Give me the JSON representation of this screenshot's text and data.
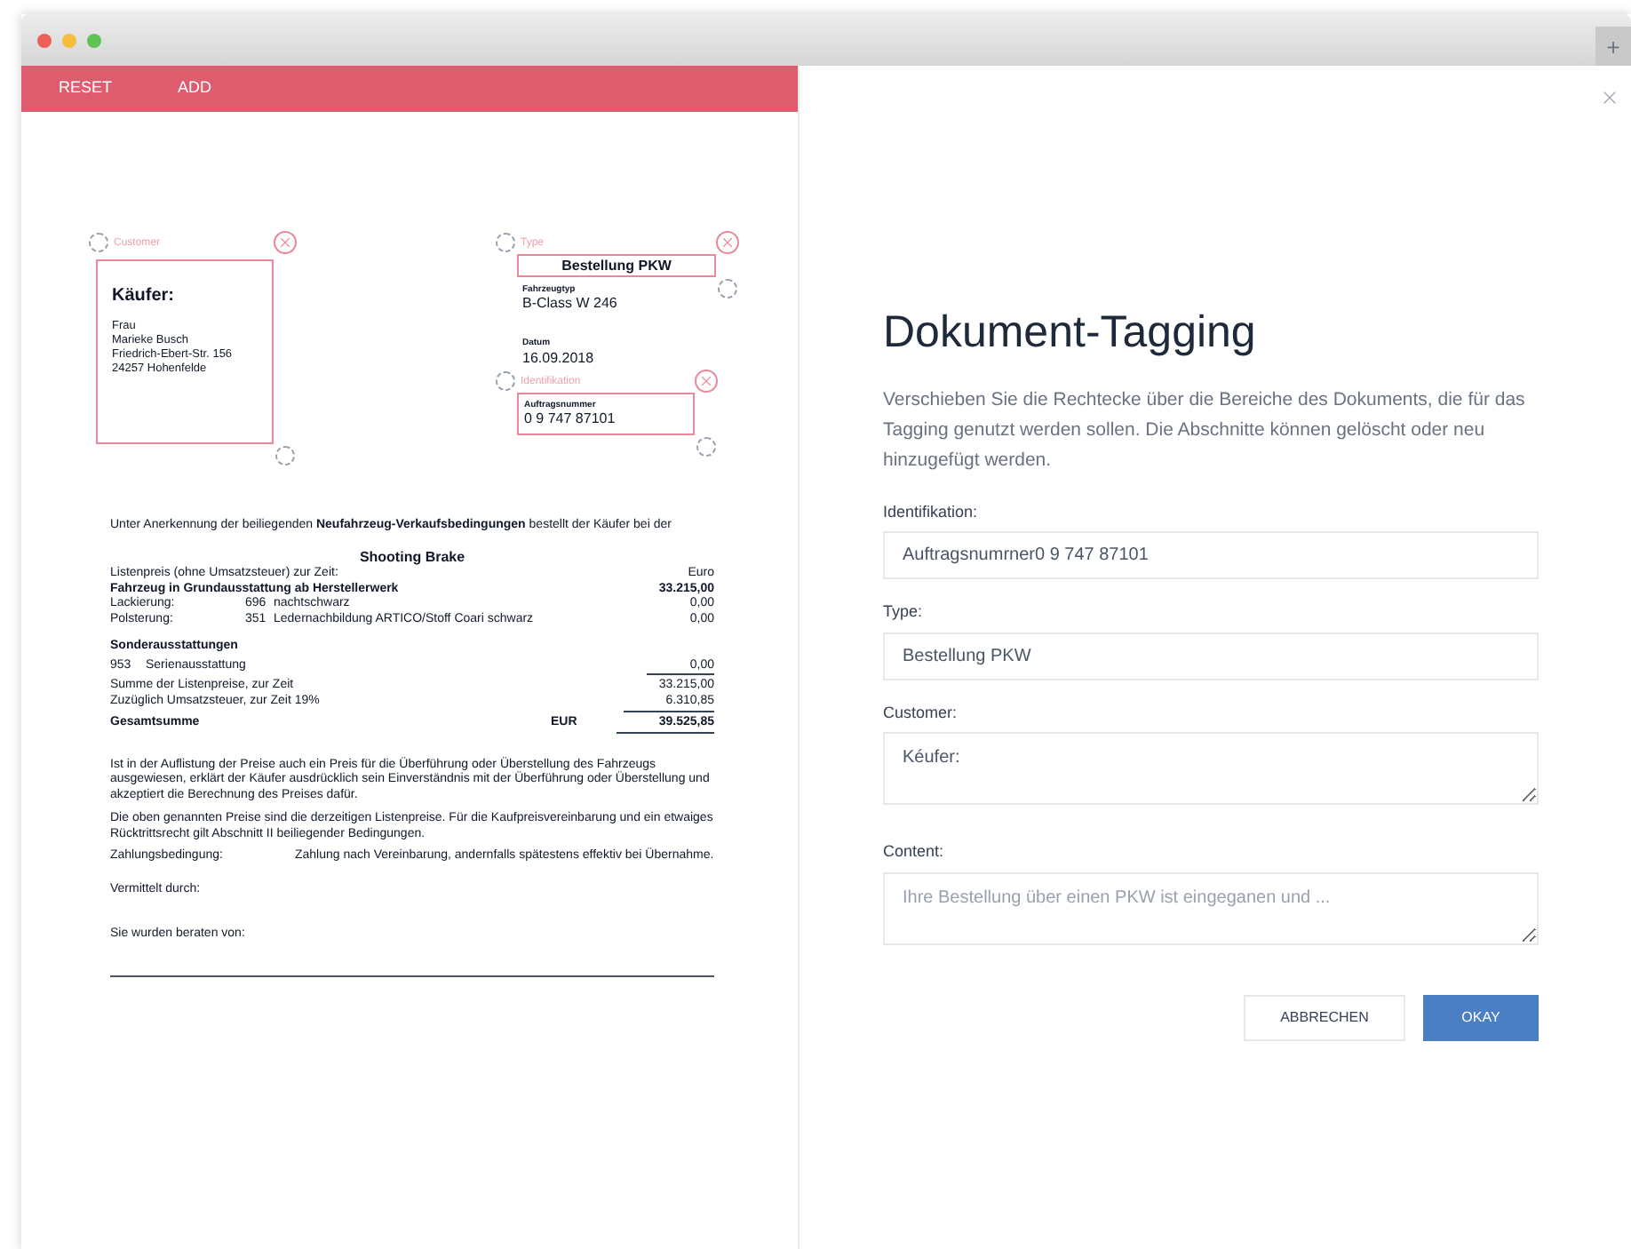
{
  "window": {
    "new_tab_button": "+"
  },
  "toolbar": {
    "buttons": [
      "RESET",
      "ADD"
    ]
  },
  "document": {
    "buyer": {
      "tag": "Customer",
      "heading": "Käufer:",
      "lines": [
        "Frau",
        "Marieke Busch",
        "Friedrich-Ebert-Str. 156",
        "24257 Hohenfelde"
      ]
    },
    "order_type": {
      "tag": "Type",
      "value": "Bestellung PKW"
    },
    "fields": [
      {
        "label": "Fahrzeugtyp",
        "value": "B-Class W 246"
      },
      {
        "label": "Datum",
        "value": "16.09.2018"
      },
      {
        "label": "Auftragsnummer",
        "value": "0 9 747 87101",
        "tag": "Identifikation"
      }
    ],
    "intro": "Unter Anerkennung der beiliegenden **Neufahrzeug-Verkaufsbedingungen** bestellt der Käufer bei der",
    "model": "Shooting Brake",
    "price_rows": [
      {
        "kind": "plain",
        "label": "Listenpreis (ohne Umsatzsteuer) zur Zeit:",
        "amount": "Euro",
        "underlined": false
      },
      {
        "kind": "bold",
        "label": "Fahrzeug in Grundausstattung ab Herstellerwerk",
        "amount": "33.215,00",
        "underlined": false
      },
      {
        "kind": "item",
        "label": "Lackierung:",
        "code": "696",
        "description": "nachtschwarz",
        "amount": "0,00",
        "underlined": false
      },
      {
        "kind": "item",
        "label": "Polsterung:",
        "code": "351",
        "description": "Ledernachbildung ARTICO/Stoff Coari schwarz",
        "amount": "0,00",
        "underlined": false
      },
      {
        "kind": "heading",
        "label": "Sonderausstattungen"
      },
      {
        "kind": "option",
        "code": "953",
        "description": "Serienausstattung",
        "amount": "0,00",
        "underlined": true
      },
      {
        "kind": "plain",
        "label": "Summe der Listenpreise, zur Zeit",
        "amount": "33.215,00",
        "underlined": false
      },
      {
        "kind": "plain",
        "label": "Zuzüglich Umsatzsteuer, zur Zeit 19%",
        "amount": "6.310,85",
        "underlined": true
      },
      {
        "kind": "total",
        "label": "Gesamtsumme",
        "currency": "EUR",
        "amount": "39.525,85",
        "underlined": true
      }
    ],
    "paragraphs": [
      "Ist in der Auflistung der Preise auch ein Preis für die Überführung oder Überstellung des Fahrzeugs ausgewiesen, erklärt der Käufer ausdrücklich sein Einverständnis mit der Überführung oder Überstellung und akzeptiert die Berechnung des Preises dafür.",
      "Die oben genannten Preise sind die derzeitigen Listenpreise. Für die Kaufpreisvereinbarung und ein etwaiges Rücktrittsrecht gilt Abschnitt II beiliegender Bedingungen."
    ],
    "terms": [
      {
        "label": "Zahlungsbedingung:",
        "value": "Zahlung nach Vereinbarung, andernfalls spätestens effektiv bei Übernahme."
      },
      {
        "label": "Vermittelt durch:"
      }
    ],
    "advisor_label": "Sie wurden beraten von:"
  },
  "form": {
    "title": "Dokument-Tagging",
    "description": "Verschieben Sie die Rechtecke über die Bereiche des Dokuments, die für das Tagging genutzt werden sollen. Die Abschnitte können gelöscht oder neu hinzugefügt werden.",
    "fields": [
      {
        "kind": "input",
        "label": "Identifikation:",
        "value": "Auftragsnumrner0 9 747 87101"
      },
      {
        "kind": "input",
        "label": "Type:",
        "value": "Bestellung PKW"
      },
      {
        "kind": "textarea",
        "label": "Customer:",
        "value": "Kéufer:"
      },
      {
        "kind": "textarea",
        "label": "Content:",
        "placeholder": "Ihre Bestellung über einen PKW ist eingeganen und ..."
      }
    ],
    "buttons": [
      {
        "kind": "secondary",
        "label": "ABBRECHEN"
      },
      {
        "kind": "primary",
        "label": "OKAY"
      }
    ]
  }
}
